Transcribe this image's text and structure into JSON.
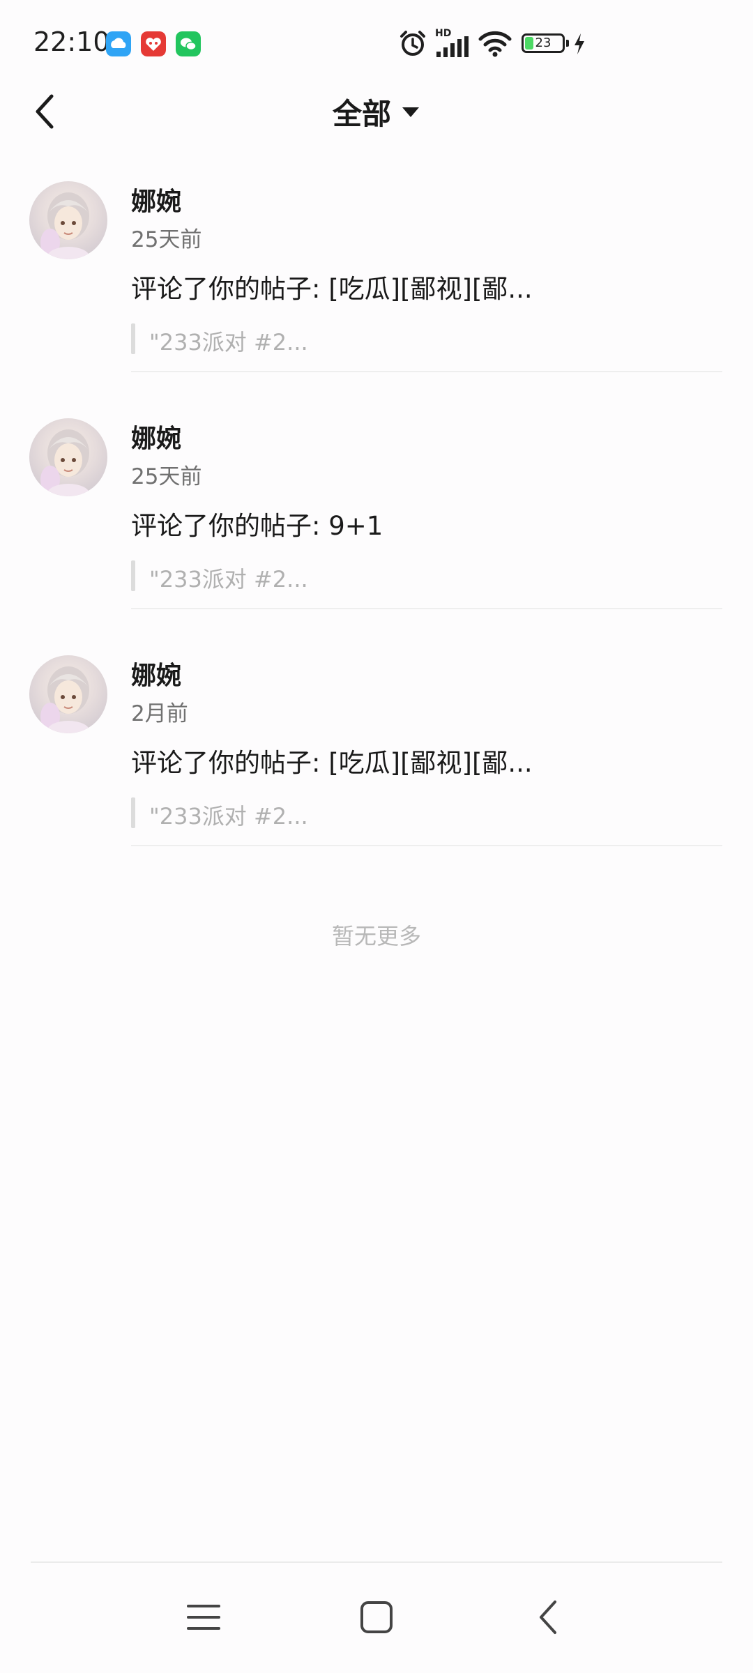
{
  "status_bar": {
    "time": "22:10",
    "network_label": "HD",
    "battery_level": "23",
    "app_icons": [
      "cloud-app-icon",
      "red-app-icon",
      "wechat-icon"
    ],
    "right_icons": [
      "alarm-icon",
      "signal-icon",
      "wifi-icon",
      "battery-icon",
      "charging-icon"
    ]
  },
  "header": {
    "title": "全部",
    "back_icon": "chevron-left-icon",
    "dropdown_icon": "caret-down-icon"
  },
  "notifications": [
    {
      "name": "娜婉",
      "time": "25天前",
      "action": "评论了你的帖子: [吃瓜][鄙视][鄙...",
      "quote": "\"233派对 #2..."
    },
    {
      "name": "娜婉",
      "time": "25天前",
      "action": "评论了你的帖子: 9+1",
      "quote": "\"233派对 #2..."
    },
    {
      "name": "娜婉",
      "time": "2月前",
      "action": "评论了你的帖子: [吃瓜][鄙视][鄙...",
      "quote": "\"233派对 #2..."
    }
  ],
  "footer_text": "暂无更多",
  "colors": {
    "background": "#fdfcfd",
    "text_primary": "#1a1a1a",
    "text_secondary": "#707070",
    "text_muted": "#b0b0b0",
    "battery_green": "#4cd964"
  }
}
